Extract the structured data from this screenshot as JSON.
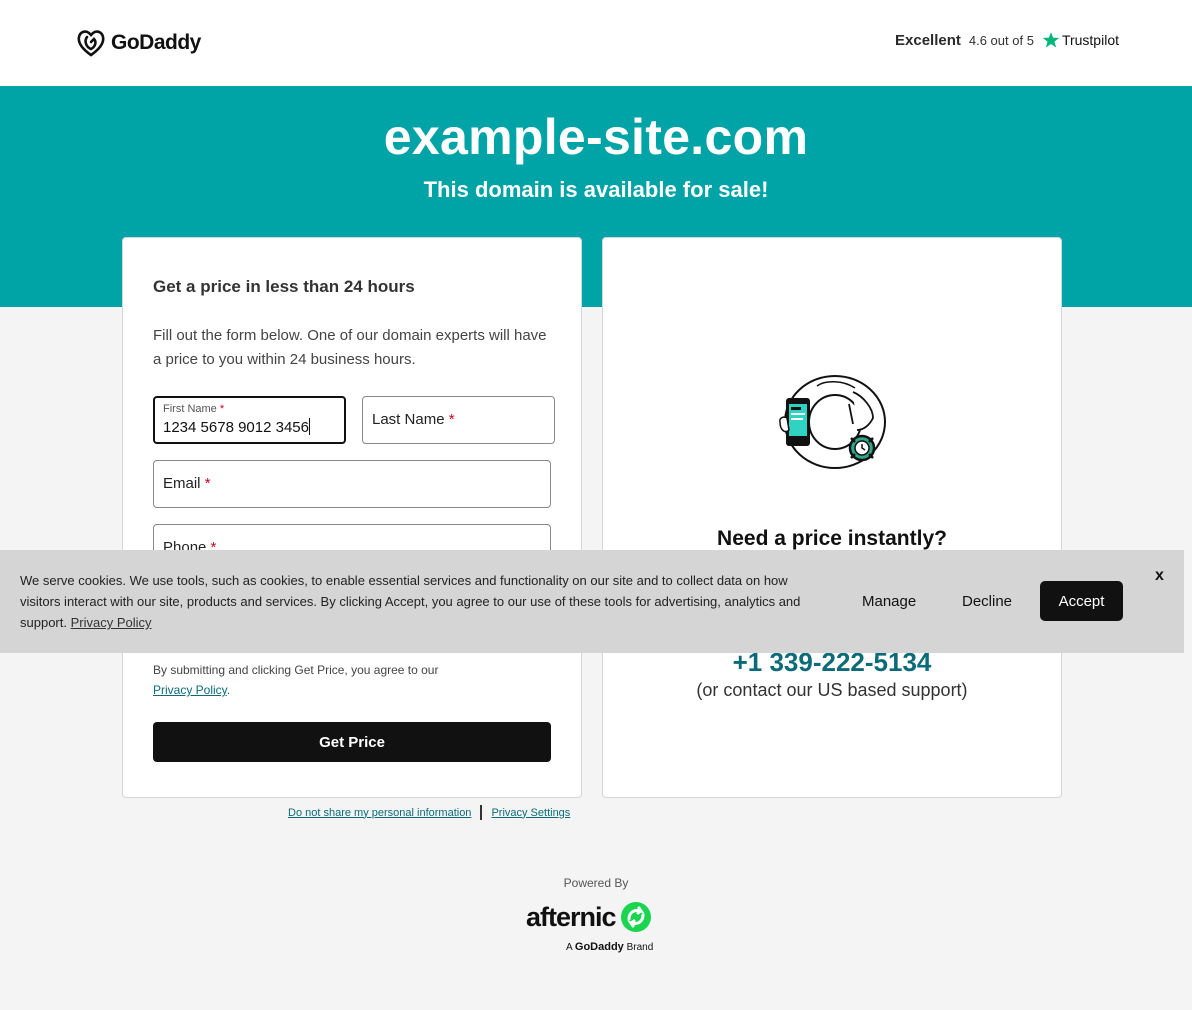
{
  "header": {
    "logo_text": "GoDaddy",
    "trust_label": "Excellent",
    "trust_score": "4.6 out of 5",
    "trust_brand": "Trustpilot"
  },
  "hero": {
    "domain": "example-site.com",
    "subtitle": "This domain is available for sale!"
  },
  "form": {
    "title": "Get a price in less than 24 hours",
    "description": "Fill out the form below. One of our domain experts will have a price to you within 24 business hours.",
    "first_name": {
      "label": "First Name",
      "value": "1234 5678 9012 3456"
    },
    "last_name": {
      "label": "Last Name"
    },
    "email": {
      "label": "Email"
    },
    "phone": {
      "label": "Phone"
    },
    "required_mark": "*",
    "agree_text": "By submitting and clicking Get Price, you agree to our",
    "agree_link": "Privacy Policy",
    "agree_end": ".",
    "submit_label": "Get Price"
  },
  "instant": {
    "title": "Need a price instantly?",
    "phone": "+1 339-222-5134",
    "contact_note": "(or contact our US based support)"
  },
  "footer": {
    "do_not_share": "Do not share my personal information",
    "privacy_settings": "Privacy Settings",
    "powered_by": "Powered By",
    "afternic": "afternic",
    "brand_prefix": "A",
    "brand_name": "GoDaddy",
    "brand_suffix": "Brand"
  },
  "cookie": {
    "text": "We serve cookies. We use tools, such as cookies, to enable essential services and functionality on our site and to collect data on how visitors interact with our site, products and services. By clicking Accept, you agree to our use of these tools for advertising, analytics and support.",
    "link": "Privacy Policy",
    "manage": "Manage",
    "decline": "Decline",
    "accept": "Accept",
    "close": "x"
  },
  "colors": {
    "hero_bg": "#00a4a6",
    "link": "#0b6b78",
    "trustpilot_green": "#00b67a",
    "afternic_green": "#1bd44f"
  }
}
